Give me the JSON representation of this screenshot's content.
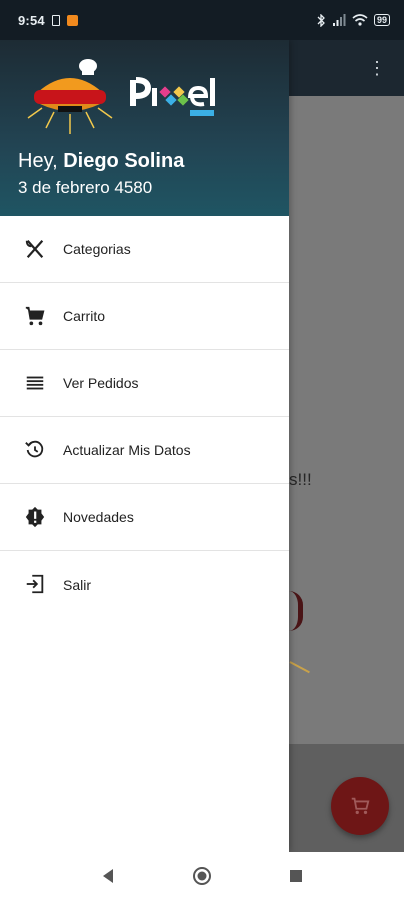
{
  "status_bar": {
    "time": "9:54",
    "battery": "99"
  },
  "drawer": {
    "greeting_prefix": "Hey, ",
    "user_name": "Diego Solina",
    "date": "3 de febrero 4580",
    "menu": [
      {
        "label": "Categorias",
        "icon": "utensils-icon"
      },
      {
        "label": "Carrito",
        "icon": "cart-icon"
      },
      {
        "label": "Ver Pedidos",
        "icon": "list-icon"
      },
      {
        "label": "Actualizar Mis Datos",
        "icon": "refresh-clock-icon"
      },
      {
        "label": "Novedades",
        "icon": "alert-badge-icon"
      },
      {
        "label": "Salir",
        "icon": "exit-icon"
      }
    ]
  },
  "background_app": {
    "peek_text": "s!!!"
  },
  "colors": {
    "header_dark": "#1d2b34",
    "header_teal": "#1f5563",
    "fab": "#6e1616",
    "scrim": "#7a7a7a"
  }
}
